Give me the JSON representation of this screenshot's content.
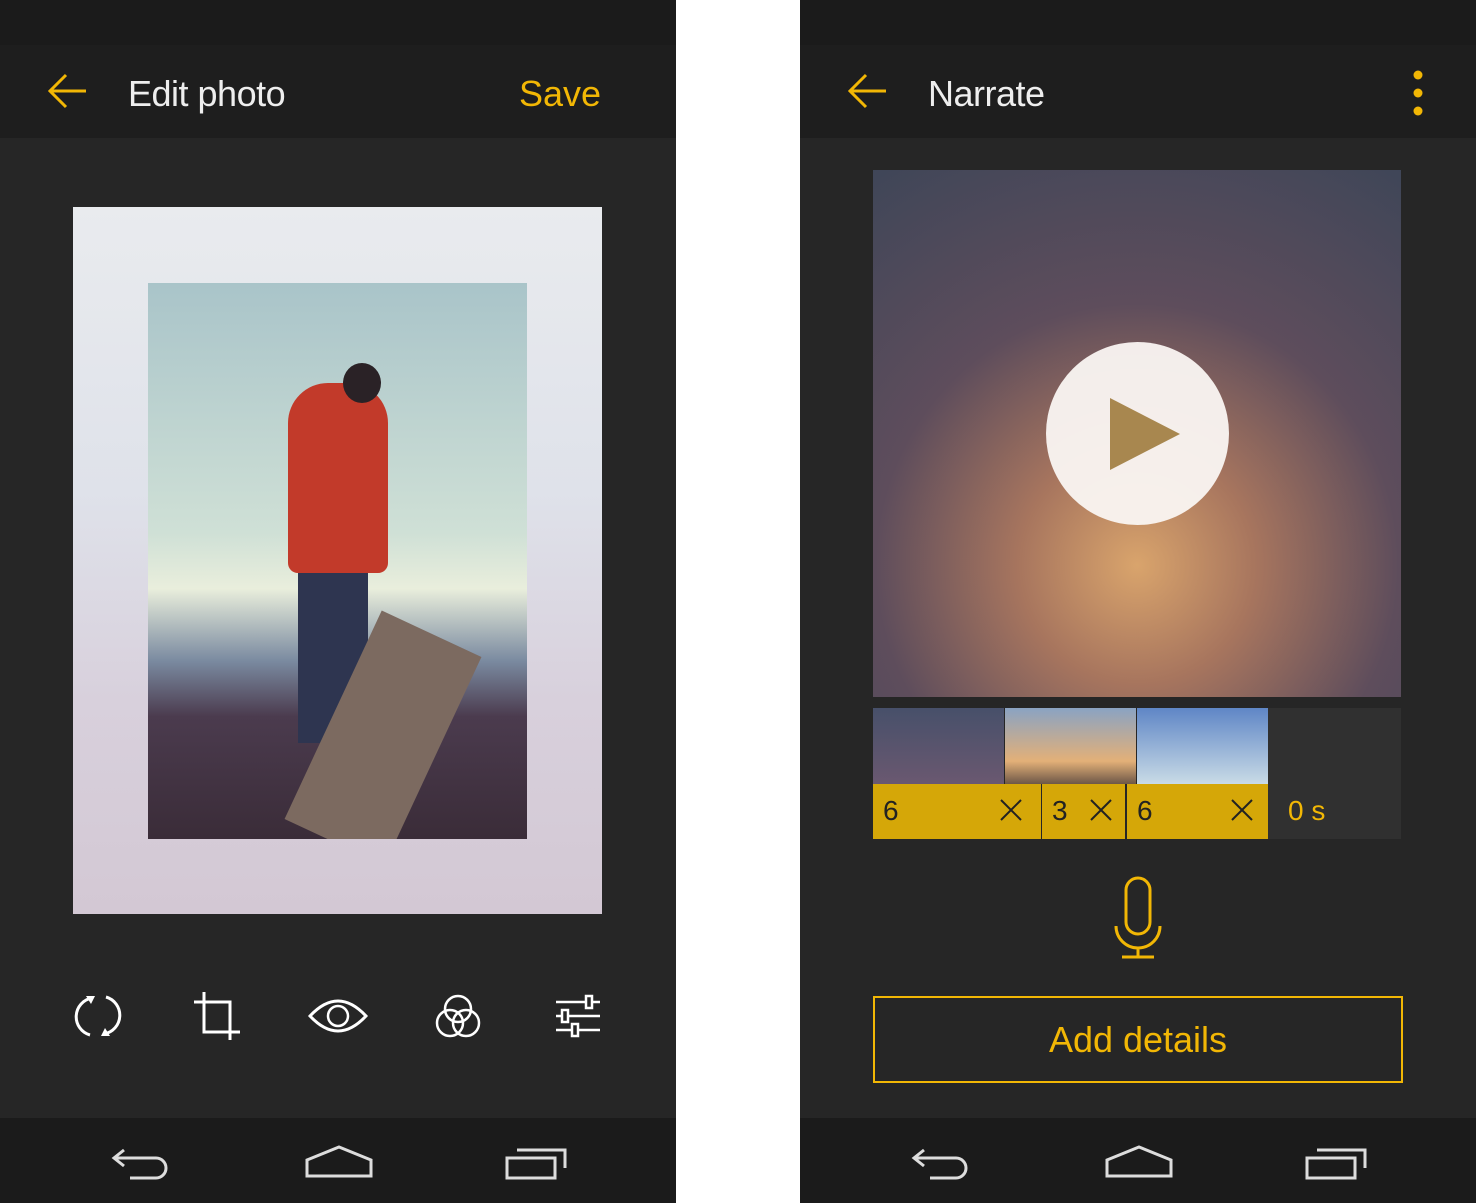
{
  "edit_screen": {
    "title": "Edit photo",
    "save_label": "Save",
    "tools": [
      "rotate-icon",
      "crop-icon",
      "eye-icon",
      "filters-icon",
      "adjust-sliders-icon"
    ]
  },
  "narrate_screen": {
    "title": "Narrate",
    "clips": [
      {
        "duration": "6"
      },
      {
        "duration": "3"
      },
      {
        "duration": "6"
      }
    ],
    "total": "0 s",
    "add_details_label": "Add details"
  },
  "colors": {
    "accent": "#f2b705",
    "background": "#262626",
    "bar": "#1e1e1e"
  }
}
